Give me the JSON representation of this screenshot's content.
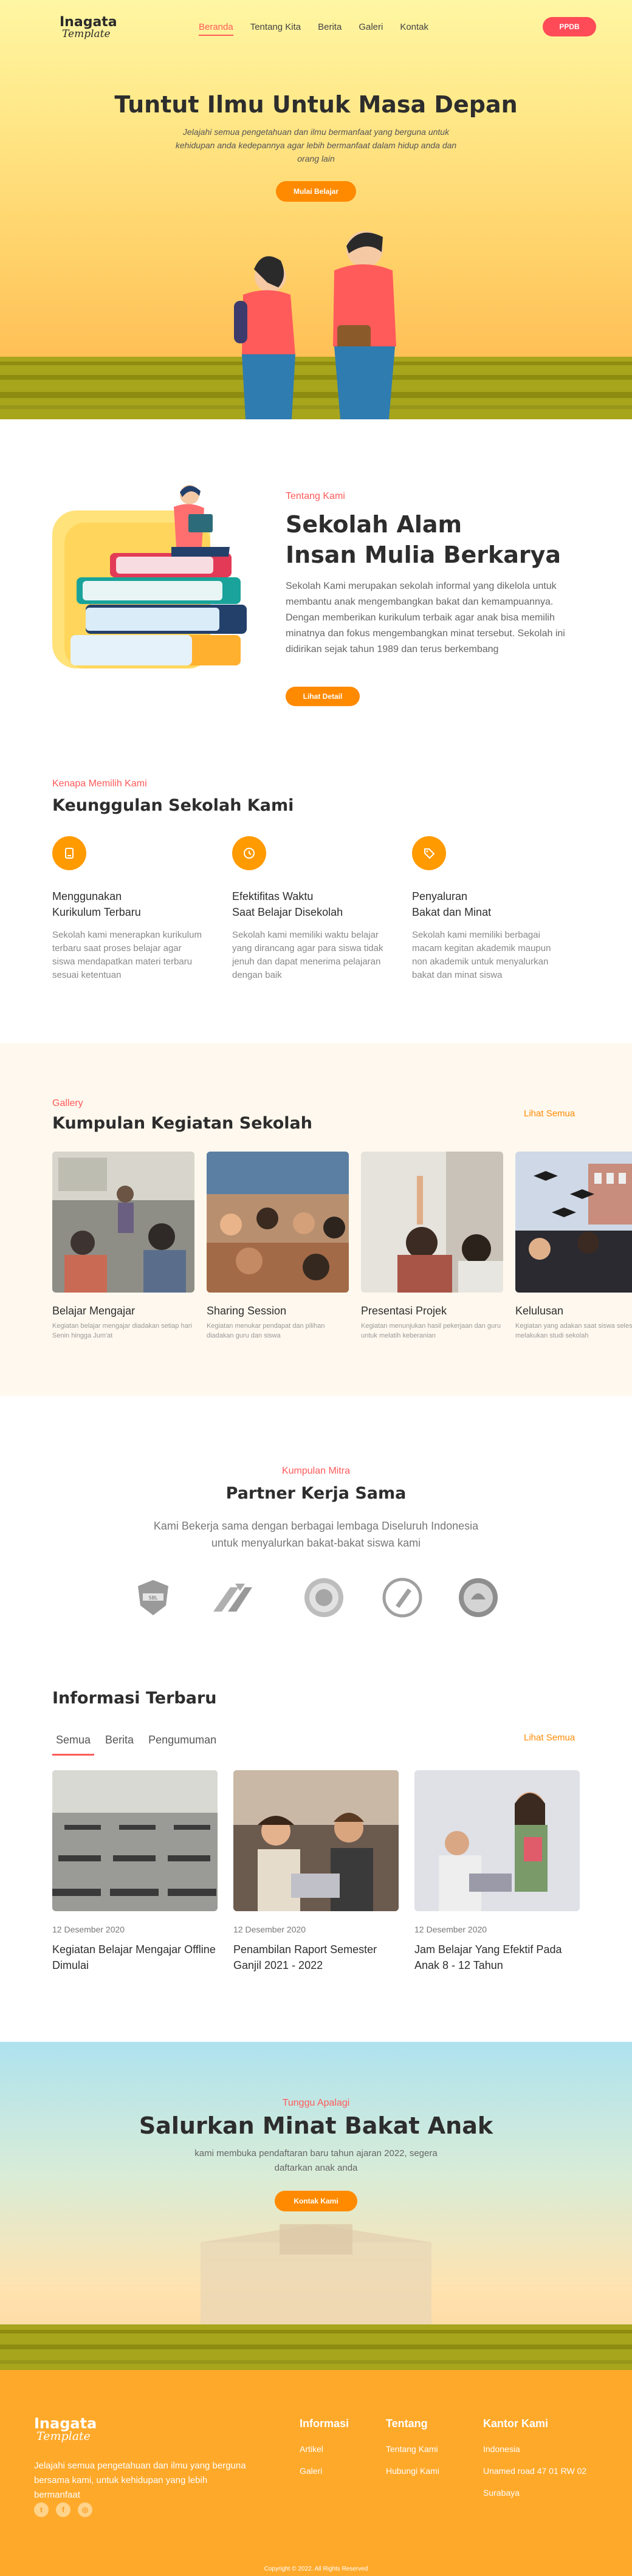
{
  "brand": {
    "name": "Inagata",
    "script": "Template"
  },
  "nav": {
    "items": [
      "Beranda",
      "Tentang Kita",
      "Berita",
      "Galeri",
      "Kontak"
    ],
    "cta": "PPDB"
  },
  "hero": {
    "title": "Tuntut Ilmu Untuk Masa Depan",
    "text": "Jelajahi semua pengetahuan dan ilmu bermanfaat yang berguna untuk kehidupan anda kedepannya agar lebih bermanfaat dalam hidup anda dan orang lain",
    "button": "Mulai Belajar"
  },
  "about": {
    "eyebrow": "Tentang Kami",
    "title_line1": "Sekolah Alam",
    "title_line2": "Insan Mulia Berkarya",
    "text": "Sekolah Kami merupakan sekolah informal yang dikelola untuk membantu anak mengembangkan bakat dan kemampuannya. Dengan memberikan kurikulum terbaik agar anak bisa memilih minatnya dan fokus mengembangkan minat tersebut. Sekolah ini didirikan sejak tahun 1989 dan terus berkembang",
    "button": "Lihat Detail"
  },
  "features": {
    "eyebrow": "Kenapa Memilih Kami",
    "title": "Keunggulan Sekolah Kami",
    "items": [
      {
        "icon": "book-icon",
        "title": "Menggunakan\nKurikulum Terbaru",
        "text": "Sekolah kami menerapkan kurikulum terbaru saat proses belajar agar siswa mendapatkan materi terbaru sesuai ketentuan"
      },
      {
        "icon": "clock-icon",
        "title": "Efektifitas Waktu\nSaat Belajar Disekolah",
        "text": "Sekolah kami memiliki waktu belajar yang dirancang agar para siswa tidak jenuh dan dapat menerima pelajaran dengan baik"
      },
      {
        "icon": "tag-icon",
        "title": "Penyaluran\nBakat dan Minat",
        "text": "Sekolah kami memiliki berbagai macam kegitan akademik maupun non akademik untuk menyalurkan bakat dan minat siswa"
      }
    ]
  },
  "gallery": {
    "eyebrow": "Gallery",
    "title": "Kumpulan Kegiatan Sekolah",
    "see_all": "Lihat Semua",
    "items": [
      {
        "title": "Belajar Mengajar",
        "text": "Kegiatan belajar mengajar diadakan setiap hari Senin hingga Jum'at"
      },
      {
        "title": "Sharing Session",
        "text": "Kegiatan menukar pendapat dan pilihan diadakan guru dan siswa"
      },
      {
        "title": "Presentasi Projek",
        "text": "Kegiatan menunjukan hasil pekerjaan dan guru untuk melatih keberanian"
      },
      {
        "title": "Kelulusan",
        "text": "Kegiatan yang adakan saat siswa selesai melakukan studi sekolah"
      }
    ]
  },
  "partners": {
    "eyebrow": "Kumpulan Mitra",
    "title": "Partner Kerja Sama",
    "text": "Kami Bekerja sama dengan berbagai lembaga Diseluruh Indonesia  untuk menyalurkan bakat-bakat siswa kami",
    "logos": [
      "shield-logo-icon",
      "arrows-logo-icon",
      "seal-logo-icon",
      "pen-logo-icon",
      "emblem-logo-icon"
    ]
  },
  "news": {
    "title": "Informasi Terbaru",
    "tabs": [
      "Semua",
      "Berita",
      "Pengumuman"
    ],
    "see_all": "Lihat Semua",
    "items": [
      {
        "date": "12 Desember 2020",
        "title": "Kegiatan Belajar Mengajar Offline Dimulai"
      },
      {
        "date": "12 Desember 2020",
        "title": "Penambilan Raport Semester Ganjil 2021 - 2022"
      },
      {
        "date": "12 Desember 2020",
        "title": "Jam Belajar Yang Efektif Pada Anak 8 - 12 Tahun"
      }
    ]
  },
  "cta": {
    "eyebrow": "Tunggu Apalagi",
    "title": "Salurkan Minat Bakat Anak",
    "text": "kami membuka pendaftaran baru tahun ajaran 2022, segera daftarkan anak anda",
    "button": "Kontak Kami"
  },
  "footer": {
    "desc": "Jelajahi semua pengetahuan dan ilmu yang berguna bersama kami, untuk kehidupan yang lebih bermanfaat",
    "socials": [
      "twitter-icon",
      "facebook-icon",
      "instagram-icon"
    ],
    "informasi": {
      "title": "Informasi",
      "links": [
        "Artikel",
        "Galeri"
      ]
    },
    "tentang": {
      "title": "Tentang",
      "links": [
        "Tentang Kami",
        "Hubungi Kami"
      ]
    },
    "kantor": {
      "title": "Kantor Kami",
      "lines": [
        "Indonesia",
        "Unamed road 47 01 RW 02",
        "Surabaya"
      ]
    },
    "copyright": "Copyright © 2022. All Rights Reserved"
  },
  "colors": {
    "accent": "#ff8a00",
    "red": "#ff5a5a",
    "footer": "#ffa92b"
  }
}
